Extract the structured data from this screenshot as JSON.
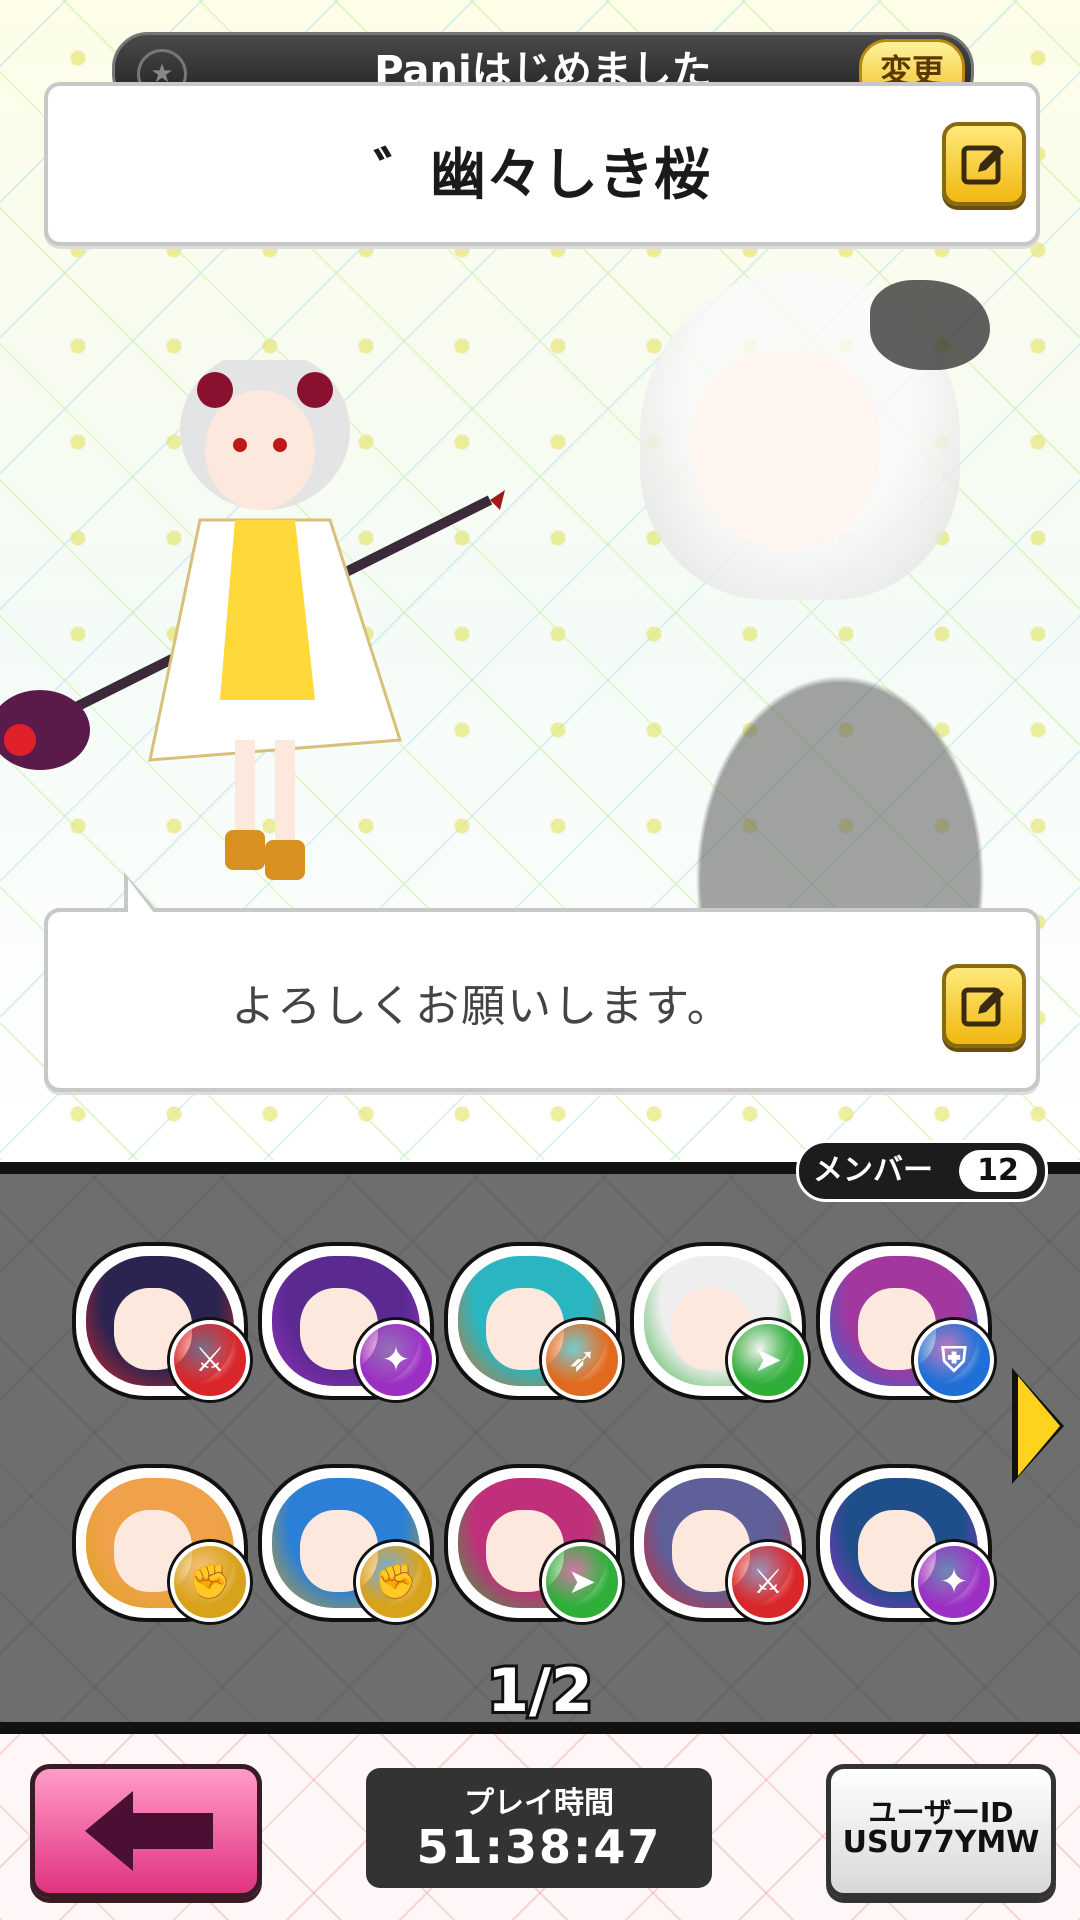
{
  "header": {
    "title": "Paniはじめました",
    "change_label": "変更",
    "player_name": "゛幽々しき桜"
  },
  "speech": {
    "message": "よろしくお願いします。"
  },
  "members": {
    "label": "メンバー",
    "count": "12",
    "page": "1/2",
    "units": [
      {
        "attr": "sword",
        "color": "#d8262a",
        "hair": "#2b2450"
      },
      {
        "attr": "staff",
        "color": "#9b2fc4",
        "hair": "#5a2a90"
      },
      {
        "attr": "bow",
        "color": "#e06a1e",
        "hair": "#2ab6c0"
      },
      {
        "attr": "spear",
        "color": "#2fae3a",
        "hair": "#eeeeee"
      },
      {
        "attr": "shield",
        "color": "#1f6fd6",
        "hair": "#a2389e"
      },
      {
        "attr": "fist",
        "color": "#d8a21a",
        "hair": "#f0a24a"
      },
      {
        "attr": "fist",
        "color": "#d8a21a",
        "hair": "#2b7fd6"
      },
      {
        "attr": "spear",
        "color": "#2fae3a",
        "hair": "#c0307a"
      },
      {
        "attr": "sword",
        "color": "#d8262a",
        "hair": "#5f5f9a"
      },
      {
        "attr": "staff",
        "color": "#9b2fc4",
        "hair": "#1e4f8a"
      }
    ]
  },
  "footer": {
    "playtime_label": "プレイ時間",
    "playtime_value": "51:38:47",
    "userid_label": "ユーザーID",
    "userid_value": "USU77YMW"
  }
}
